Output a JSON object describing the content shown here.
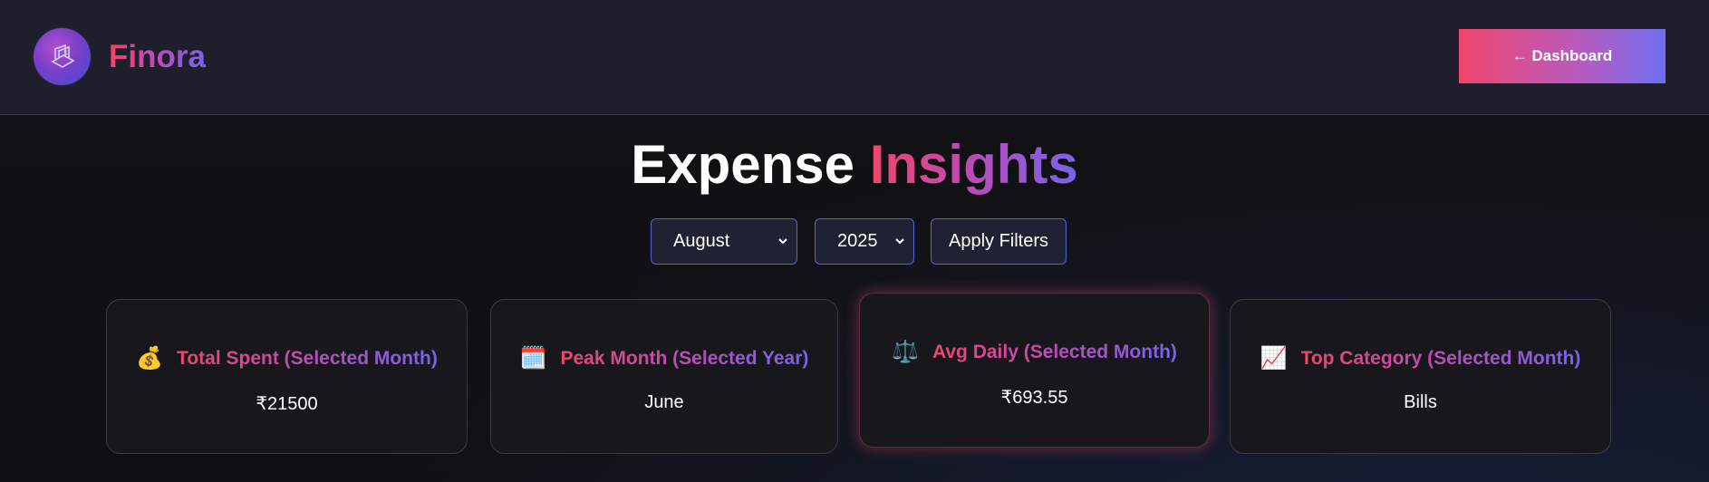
{
  "brand": {
    "name": "Finora"
  },
  "header": {
    "dashboard_button": "← Dashboard"
  },
  "title": {
    "part1": "Expense ",
    "part2": "Insights"
  },
  "filters": {
    "month": "August",
    "year": "2025",
    "apply_label": "Apply Filters"
  },
  "cards": [
    {
      "icon": "money-bag-icon",
      "emoji": "💰",
      "label": "Total Spent (Selected Month)",
      "value": "₹21500"
    },
    {
      "icon": "calendar-icon",
      "emoji": "🗓️",
      "label": "Peak Month (Selected Year)",
      "value": "June"
    },
    {
      "icon": "balance-scale-icon",
      "emoji": "⚖️",
      "label": "Avg Daily (Selected Month)",
      "value": "₹693.55"
    },
    {
      "icon": "chart-increasing-icon",
      "emoji": "📈",
      "label": "Top Category (Selected Month)",
      "value": "Bills"
    }
  ],
  "colors": {
    "accent_pink": "#f0456b",
    "accent_violet": "#7565e8",
    "header_bg": "#1f1e2c",
    "card_bg": "#18181c"
  }
}
